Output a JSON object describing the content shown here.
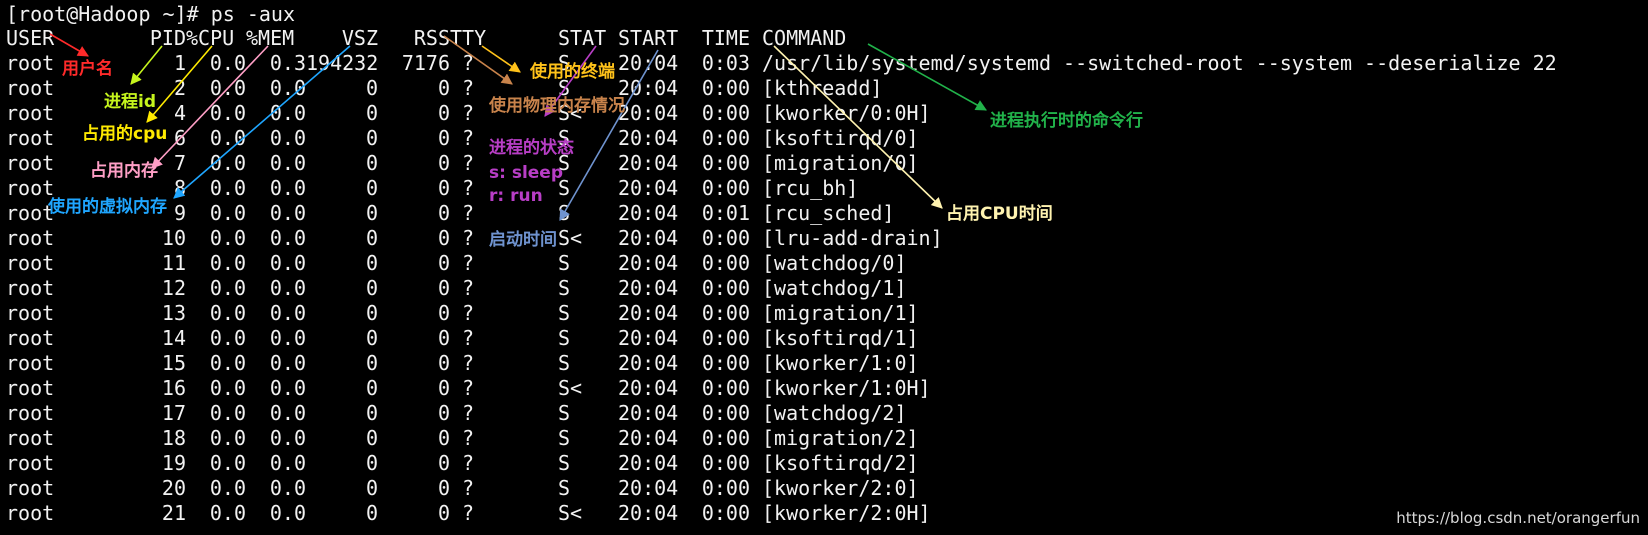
{
  "terminal": {
    "prompt": "[root@Hadoop ~]# ps -aux",
    "headers": {
      "user": "USER",
      "pid": "PID",
      "cpu": "%CPU",
      "mem": "%MEM",
      "vsz": "VSZ",
      "rss": "RSS",
      "tty": "TTY",
      "stat": "STAT",
      "start": "START",
      "time": "TIME",
      "command": "COMMAND"
    },
    "rows": [
      [
        "root",
        "1",
        "0.0",
        "0.3",
        "194232",
        "7176",
        "?",
        "S",
        "20:04",
        "0:03",
        "/usr/lib/systemd/systemd --switched-root --system --deserialize 22"
      ],
      [
        "root",
        "2",
        "0.0",
        "0.0",
        "0",
        "0",
        "?",
        "S",
        "20:04",
        "0:00",
        "[kthreadd]"
      ],
      [
        "root",
        "4",
        "0.0",
        "0.0",
        "0",
        "0",
        "?",
        "S<",
        "20:04",
        "0:00",
        "[kworker/0:0H]"
      ],
      [
        "root",
        "6",
        "0.0",
        "0.0",
        "0",
        "0",
        "?",
        "S",
        "20:04",
        "0:00",
        "[ksoftirqd/0]"
      ],
      [
        "root",
        "7",
        "0.0",
        "0.0",
        "0",
        "0",
        "?",
        "S",
        "20:04",
        "0:00",
        "[migration/0]"
      ],
      [
        "root",
        "8",
        "0.0",
        "0.0",
        "0",
        "0",
        "?",
        "S",
        "20:04",
        "0:00",
        "[rcu_bh]"
      ],
      [
        "root",
        "9",
        "0.0",
        "0.0",
        "0",
        "0",
        "?",
        "S",
        "20:04",
        "0:01",
        "[rcu_sched]"
      ],
      [
        "root",
        "10",
        "0.0",
        "0.0",
        "0",
        "0",
        "?",
        "S<",
        "20:04",
        "0:00",
        "[lru-add-drain]"
      ],
      [
        "root",
        "11",
        "0.0",
        "0.0",
        "0",
        "0",
        "?",
        "S",
        "20:04",
        "0:00",
        "[watchdog/0]"
      ],
      [
        "root",
        "12",
        "0.0",
        "0.0",
        "0",
        "0",
        "?",
        "S",
        "20:04",
        "0:00",
        "[watchdog/1]"
      ],
      [
        "root",
        "13",
        "0.0",
        "0.0",
        "0",
        "0",
        "?",
        "S",
        "20:04",
        "0:00",
        "[migration/1]"
      ],
      [
        "root",
        "14",
        "0.0",
        "0.0",
        "0",
        "0",
        "?",
        "S",
        "20:04",
        "0:00",
        "[ksoftirqd/1]"
      ],
      [
        "root",
        "15",
        "0.0",
        "0.0",
        "0",
        "0",
        "?",
        "S",
        "20:04",
        "0:00",
        "[kworker/1:0]"
      ],
      [
        "root",
        "16",
        "0.0",
        "0.0",
        "0",
        "0",
        "?",
        "S<",
        "20:04",
        "0:00",
        "[kworker/1:0H]"
      ],
      [
        "root",
        "17",
        "0.0",
        "0.0",
        "0",
        "0",
        "?",
        "S",
        "20:04",
        "0:00",
        "[watchdog/2]"
      ],
      [
        "root",
        "18",
        "0.0",
        "0.0",
        "0",
        "0",
        "?",
        "S",
        "20:04",
        "0:00",
        "[migration/2]"
      ],
      [
        "root",
        "19",
        "0.0",
        "0.0",
        "0",
        "0",
        "?",
        "S",
        "20:04",
        "0:00",
        "[ksoftirqd/2]"
      ],
      [
        "root",
        "20",
        "0.0",
        "0.0",
        "0",
        "0",
        "?",
        "S",
        "20:04",
        "0:00",
        "[kworker/2:0]"
      ],
      [
        "root",
        "21",
        "0.0",
        "0.0",
        "0",
        "0",
        "?",
        "S<",
        "20:04",
        "0:00",
        "[kworker/2:0H]"
      ]
    ]
  },
  "annotations": [
    {
      "key": "user",
      "text": "用户名",
      "color": "#ff2a2a"
    },
    {
      "key": "pid",
      "text": "进程id",
      "color": "#c6f51d"
    },
    {
      "key": "cpu",
      "text": "占用的cpu",
      "color": "#ffea00"
    },
    {
      "key": "mem",
      "text": "占用内存",
      "color": "#ff9fc6"
    },
    {
      "key": "vsz",
      "text": "使用的虚拟内存",
      "color": "#1fa6ff"
    },
    {
      "key": "tty",
      "text": "使用的终端",
      "color": "#ffc21a"
    },
    {
      "key": "rss",
      "text": "使用物理内存情况",
      "color": "#c8834b"
    },
    {
      "key": "stat",
      "text": "进程的状态",
      "color": "#b83ec6"
    },
    {
      "key": "stat_sleep",
      "text": "s: sleep",
      "color": "#b83ec6"
    },
    {
      "key": "stat_run",
      "text": "r: run",
      "color": "#b83ec6"
    },
    {
      "key": "start",
      "text": "启动时间",
      "color": "#6f93cf"
    },
    {
      "key": "time",
      "text": "占用CPU时间",
      "color": "#fff3b0"
    },
    {
      "key": "command",
      "text": "进程执行时的命令行",
      "color": "#21b24a"
    }
  ],
  "watermark": "https://blog.csdn.net/orangerfun"
}
